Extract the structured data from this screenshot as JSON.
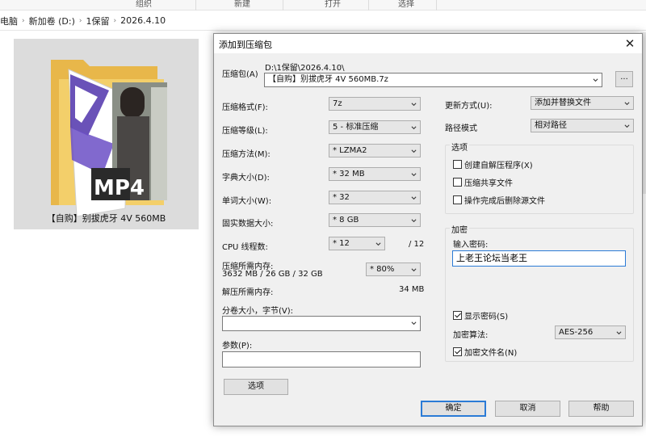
{
  "explorer": {
    "ribbon_groups": [
      "组织",
      "新建",
      "打开",
      "选择"
    ],
    "breadcrumb": [
      "电脑",
      "新加卷 (D:)",
      "1保留",
      "2026.4.10"
    ],
    "file": {
      "name": "【自购】别拔虎牙 4V 560MB",
      "badge": "MP4"
    }
  },
  "dialog": {
    "title": "添加到压缩包",
    "archive": {
      "label": "压缩包(A)",
      "path": "D:\\1保留\\2026.4.10\\",
      "filename": "【自购】别拔虎牙 4V 560MB.7z",
      "browse": "..."
    },
    "left": {
      "format": {
        "label": "压缩格式(F):",
        "value": "7z"
      },
      "level": {
        "label": "压缩等级(L):",
        "value": "5 - 标准压缩"
      },
      "method": {
        "label": "压缩方法(M):",
        "value": "* LZMA2"
      },
      "dict": {
        "label": "字典大小(D):",
        "value": "* 32 MB"
      },
      "word": {
        "label": "单词大小(W):",
        "value": "* 32"
      },
      "solid": {
        "label": "固实数据大小:",
        "value": "* 8 GB"
      },
      "cpu": {
        "label": "CPU 线程数:",
        "value": "* 12",
        "max": "/ 12"
      },
      "mem": {
        "label": "压缩所需内存:",
        "detail": "3632 MB / 26 GB / 32 GB",
        "value": "* 80%"
      },
      "unmem": {
        "label": "解压所需内存:",
        "value": "34 MB"
      },
      "volume": {
        "label": "分卷大小，字节(V):",
        "value": ""
      },
      "params": {
        "label": "参数(P):",
        "value": ""
      },
      "options_button": "选项"
    },
    "right": {
      "update": {
        "label": "更新方式(U):",
        "value": "添加并替换文件"
      },
      "pathmode": {
        "label": "路径模式",
        "value": "相对路径"
      },
      "options": {
        "title": "选项",
        "sfx": {
          "label": "创建自解压程序(X)",
          "checked": false
        },
        "shared": {
          "label": "压缩共享文件",
          "checked": false
        },
        "delete": {
          "label": "操作完成后删除源文件",
          "checked": false
        }
      },
      "encryption": {
        "title": "加密",
        "password_label": "输入密码:",
        "password": "上老王论坛当老王",
        "show": {
          "label": "显示密码(S)",
          "checked": true
        },
        "method_label": "加密算法:",
        "method": "AES-256",
        "names": {
          "label": "加密文件名(N)",
          "checked": true
        }
      }
    },
    "buttons": {
      "ok": "确定",
      "cancel": "取消",
      "help": "帮助"
    }
  },
  "colors": {
    "accent": "#2b7bd6",
    "dialog_bg": "#f0f0f0"
  }
}
